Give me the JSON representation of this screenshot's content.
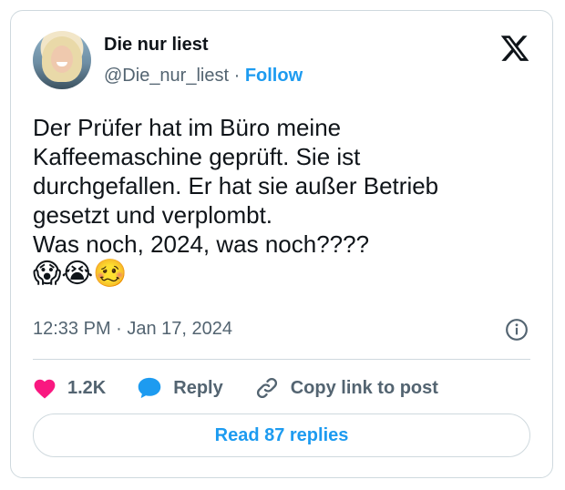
{
  "user": {
    "name": "Die nur liest",
    "handle": "@Die_nur_liest",
    "separator": " · ",
    "follow_label": "Follow"
  },
  "tweet": {
    "text": "Der Prüfer hat im Büro meine\nKaffeemaschine geprüft. Sie ist\ndurchgefallen. Er hat sie außer Betrieb\ngesetzt und verplombt.\nWas noch, 2024, was noch????",
    "emojis": "😱😭🥴",
    "timestamp": "12:33 PM · Jan 17, 2024"
  },
  "actions": {
    "like_count": "1.2K",
    "reply_label": "Reply",
    "copy_link_label": "Copy link to post"
  },
  "read_replies_label": "Read 87 replies",
  "icons": {
    "logo": "x-logo-icon",
    "info": "info-icon",
    "like": "heart-icon",
    "reply": "speech-bubble-icon",
    "link": "link-icon"
  },
  "colors": {
    "accent": "#1d9bf0",
    "heart": "#f91880",
    "secondary_text": "#536471",
    "border": "#cfd9de"
  }
}
